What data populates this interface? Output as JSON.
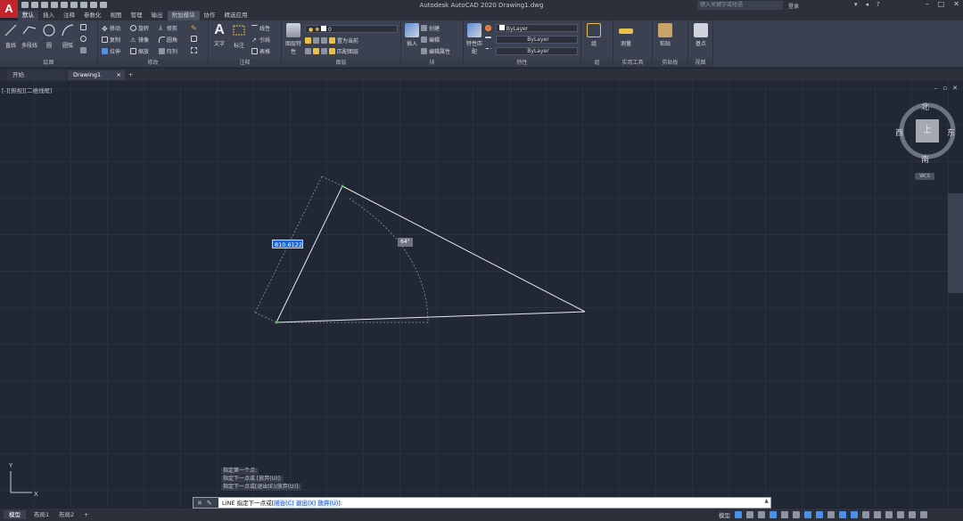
{
  "app": {
    "logo": "A",
    "title": "Autodesk AutoCAD 2020    Drawing1.dwg",
    "search_placeholder": "键入关键字或短语",
    "login": "登录"
  },
  "ribbon_tabs": [
    "默认",
    "插入",
    "注释",
    "参数化",
    "视图",
    "管理",
    "输出",
    "附加模块",
    "协作",
    "精选应用"
  ],
  "ribbon": {
    "draw": {
      "title": "绘图",
      "line": "直线",
      "polyline": "多段线",
      "circle": "圆",
      "arc": "圆弧"
    },
    "modify": {
      "title": "修改",
      "move": "移动",
      "rotate": "旋转",
      "trim": "修剪",
      "copy": "复制",
      "mirror": "镜像",
      "fillet": "圆角",
      "stretch": "拉伸",
      "scale": "缩放",
      "array": "阵列"
    },
    "annotation": {
      "title": "注释",
      "text": "文字",
      "dimension": "标注",
      "linear": "线性",
      "leader": "引线",
      "table": "表格"
    },
    "layers": {
      "title": "图层",
      "layer_props": "图层特性",
      "layer_value": "0",
      "make_current": "置为当前",
      "match_layer": "匹配图层"
    },
    "block": {
      "title": "块",
      "insert": "插入",
      "create": "创建",
      "edit": "编辑",
      "edit_attr": "编辑属性"
    },
    "properties": {
      "title": "特性",
      "match_props": "特性匹配",
      "color": "ByLayer",
      "linetype": "ByLayer",
      "lineweight": "ByLayer"
    },
    "groups": {
      "title": "组",
      "group": "组"
    },
    "utilities": {
      "title": "实用工具",
      "measure": "测量"
    },
    "clipboard": {
      "title": "剪贴板",
      "paste": "粘贴"
    },
    "view": {
      "title": "视图",
      "base": "基点"
    }
  },
  "file_tabs": [
    {
      "label": "开始"
    },
    {
      "label": "Drawing1",
      "close": "×"
    }
  ],
  "add_tab": "+",
  "viewport": {
    "label": "[-][俯视][二维线框]",
    "compass": {
      "north": "北",
      "south": "南",
      "east": "东",
      "west": "西",
      "top": "上"
    },
    "wcs": "WCS",
    "dim_input": "810.6122",
    "angle": "64°",
    "ucs_x": "X",
    "ucs_y": "Y"
  },
  "command_history": [
    "指定第一个点:",
    "指定下一点或 [放弃(U)]:",
    "指定下一点或[退出(E)/放弃(U)]:"
  ],
  "command_line": {
    "prefix": "LINE 指定下一点或[",
    "opt_close": "闭合(C)",
    "opt_exit": "退出(X)",
    "opt_undo": "放弃(U)",
    "suffix": "]:"
  },
  "status": {
    "tabs": [
      "模型",
      "布局1",
      "布局2"
    ],
    "add": "+",
    "model_label": "模型"
  },
  "colors": {
    "background": "#212735",
    "ribbon": "#3b4150",
    "accent": "#1c67d8",
    "logo": "#c0252c"
  }
}
